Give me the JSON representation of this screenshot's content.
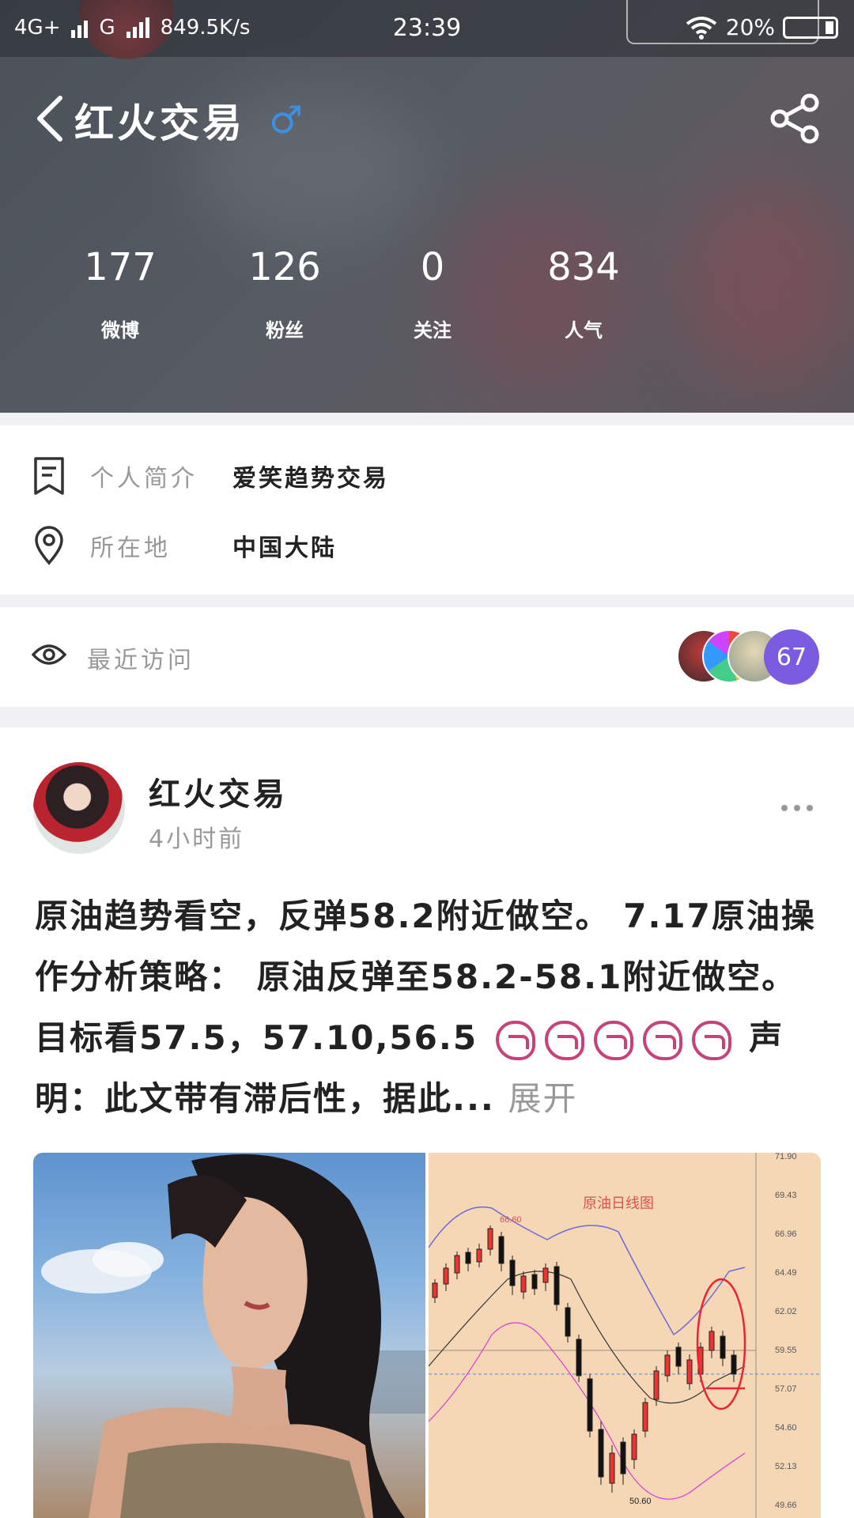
{
  "status_bar": {
    "network1": "4G+",
    "network2": "G",
    "speed": "849.5K/s",
    "time": "23:39",
    "battery": "20%"
  },
  "header": {
    "title": "红火交易",
    "gender_symbol": "♂"
  },
  "stats": [
    {
      "value": "177",
      "label": "微博"
    },
    {
      "value": "126",
      "label": "粉丝"
    },
    {
      "value": "0",
      "label": "关注"
    },
    {
      "value": "834",
      "label": "人气"
    }
  ],
  "profile": {
    "bio_label": "个人简介",
    "bio_value": "爱笑趋势交易",
    "location_label": "所在地",
    "location_value": "中国大陆"
  },
  "visits": {
    "label": "最近访问",
    "count": "67"
  },
  "post": {
    "author": "红火交易",
    "time": "4小时前",
    "text_part1": "原油趋势看空，反弹58.2附近做空。 7.17原油操作分析策略： 原油反弹至58.2-58.1附近做空。目标看57.5，57.10,56.5 ",
    "text_part2": " 声明：此文带有滞后性，据此... ",
    "expand_label": "展开"
  },
  "chart_image": {
    "title": "原油日线图",
    "y_ticks": [
      "71.90",
      "69.43",
      "66.96",
      "64.49",
      "62.02",
      "59.55",
      "57.07",
      "54.60",
      "52.13",
      "49.66"
    ],
    "high_label": "66.60",
    "low_label": "50.60"
  },
  "colors": {
    "accent_male": "#3d8fe0",
    "visit_badge": "#7b5ce0",
    "emoji": "#c9417a",
    "chart_bg": "#f5d7b6"
  }
}
